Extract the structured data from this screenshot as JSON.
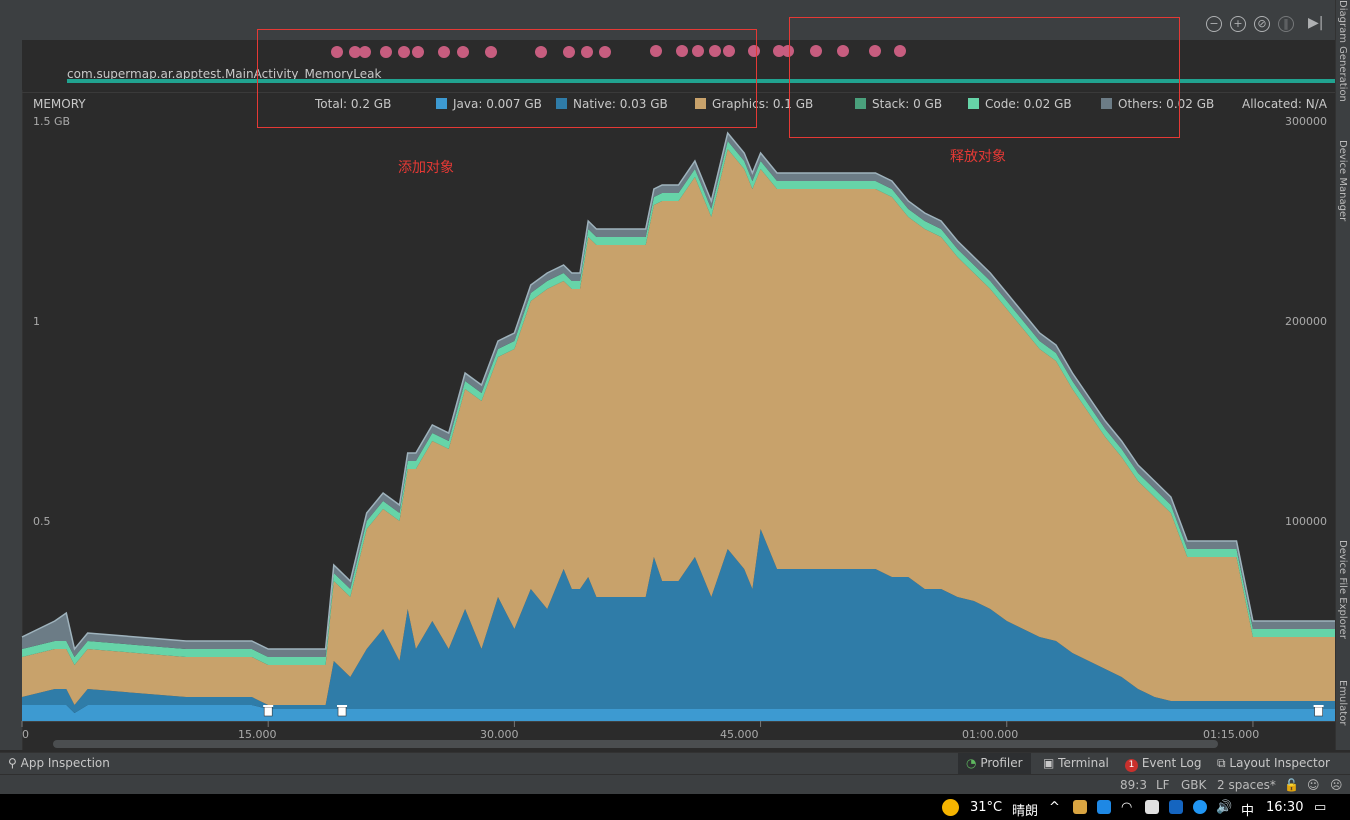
{
  "app": {
    "title": "Android Studio Memory Profiler"
  },
  "toolbar": {
    "icons": [
      "zoom-out-icon",
      "zoom-in-icon",
      "reset-zoom-icon",
      "pause-icon",
      "go-live-icon"
    ]
  },
  "right_strip": {
    "labels": [
      "Diagram Generation",
      "Device Manager",
      "Device File Explorer",
      "Emulator"
    ]
  },
  "session": {
    "label": "com.supermap.ar.apptest.MainActivity_MemoryLeak"
  },
  "legend": {
    "title": "MEMORY",
    "total": "Total: 0.2 GB",
    "java": "Java: 0.007 GB",
    "native": "Native: 0.03 GB",
    "graphics": "Graphics: 0.1 GB",
    "stack": "Stack: 0 GB",
    "code": "Code: 0.02 GB",
    "others": "Others: 0.02 GB",
    "allocated": "Allocated: N/A"
  },
  "colors": {
    "java": "#3d9ad1",
    "native": "#2f7ca8",
    "graphics": "#c8a26b",
    "stack": "#4aa07c",
    "code": "#66d4a8",
    "others": "#6c7c86",
    "event_dot": "#c75d7f",
    "annotation": "#e53935",
    "session_bar": "#21a390"
  },
  "annotations": {
    "add": "添加对象",
    "release": "释放对象"
  },
  "chart_data": {
    "type": "area",
    "title": "",
    "y_left_ticks": [
      "1.5 GB",
      "1",
      "0.5"
    ],
    "y_right_ticks": [
      "300000",
      "200000",
      "100000"
    ],
    "x_ticks": [
      "0",
      "15.000",
      "30.000",
      "45.000",
      "01:00.000",
      "01:15.000"
    ],
    "ylim": [
      0,
      1.5
    ],
    "xlim_seconds": [
      0,
      80
    ],
    "x": [
      0,
      1,
      2,
      2.7,
      3.2,
      4,
      10,
      14,
      15,
      18.5,
      19,
      20,
      21,
      22,
      23,
      23.5,
      24,
      25,
      26,
      27,
      28,
      29,
      30,
      31,
      32,
      33,
      33.5,
      34,
      34.5,
      35,
      36,
      36.5,
      38,
      38.5,
      39,
      40,
      41,
      42,
      43,
      44,
      44.5,
      45,
      46,
      47,
      48,
      49,
      50,
      51,
      52,
      53,
      54,
      55,
      56,
      57,
      58,
      59,
      60,
      61,
      62,
      63,
      64,
      65,
      66,
      67,
      68,
      69,
      70,
      71,
      72,
      73,
      74,
      75,
      76,
      77,
      78,
      79,
      80
    ],
    "series": [
      {
        "name": "Java",
        "values": [
          0.04,
          0.04,
          0.04,
          0.04,
          0.02,
          0.04,
          0.04,
          0.04,
          0.03,
          0.03,
          0.03,
          0.03,
          0.03,
          0.03,
          0.03,
          0.03,
          0.03,
          0.03,
          0.03,
          0.03,
          0.03,
          0.03,
          0.03,
          0.03,
          0.03,
          0.03,
          0.03,
          0.03,
          0.03,
          0.03,
          0.03,
          0.03,
          0.03,
          0.03,
          0.03,
          0.03,
          0.03,
          0.03,
          0.03,
          0.03,
          0.03,
          0.03,
          0.03,
          0.03,
          0.03,
          0.03,
          0.03,
          0.03,
          0.03,
          0.03,
          0.03,
          0.03,
          0.03,
          0.03,
          0.03,
          0.03,
          0.03,
          0.03,
          0.03,
          0.03,
          0.03,
          0.03,
          0.03,
          0.03,
          0.03,
          0.03,
          0.03,
          0.03,
          0.03,
          0.03,
          0.03,
          0.03,
          0.03,
          0.03,
          0.03,
          0.03,
          0.03
        ]
      },
      {
        "name": "Native",
        "values": [
          0.02,
          0.03,
          0.04,
          0.04,
          0.02,
          0.04,
          0.02,
          0.02,
          0.01,
          0.01,
          0.12,
          0.08,
          0.15,
          0.2,
          0.12,
          0.25,
          0.15,
          0.22,
          0.15,
          0.25,
          0.15,
          0.28,
          0.2,
          0.3,
          0.25,
          0.35,
          0.3,
          0.3,
          0.33,
          0.28,
          0.28,
          0.28,
          0.28,
          0.38,
          0.32,
          0.32,
          0.38,
          0.28,
          0.4,
          0.35,
          0.3,
          0.45,
          0.35,
          0.35,
          0.35,
          0.35,
          0.35,
          0.35,
          0.35,
          0.33,
          0.33,
          0.3,
          0.3,
          0.28,
          0.27,
          0.25,
          0.22,
          0.2,
          0.18,
          0.17,
          0.14,
          0.12,
          0.1,
          0.08,
          0.05,
          0.03,
          0.02,
          0.02,
          0.02,
          0.02,
          0.02,
          0.02,
          0.02,
          0.02,
          0.02,
          0.02,
          0.02
        ]
      },
      {
        "name": "Graphics",
        "values": [
          0.1,
          0.1,
          0.1,
          0.1,
          0.1,
          0.1,
          0.1,
          0.1,
          0.1,
          0.1,
          0.2,
          0.2,
          0.3,
          0.3,
          0.35,
          0.35,
          0.45,
          0.45,
          0.5,
          0.55,
          0.62,
          0.6,
          0.7,
          0.72,
          0.8,
          0.72,
          0.75,
          0.75,
          0.85,
          0.88,
          0.88,
          0.88,
          0.88,
          0.88,
          0.95,
          0.95,
          0.95,
          0.95,
          1.0,
          1.0,
          1.0,
          0.9,
          0.95,
          0.95,
          0.95,
          0.95,
          0.95,
          0.95,
          0.95,
          0.95,
          0.9,
          0.9,
          0.88,
          0.85,
          0.82,
          0.8,
          0.78,
          0.75,
          0.72,
          0.7,
          0.66,
          0.62,
          0.58,
          0.55,
          0.52,
          0.5,
          0.47,
          0.36,
          0.36,
          0.36,
          0.36,
          0.16,
          0.16,
          0.16,
          0.16,
          0.16,
          0.16
        ]
      },
      {
        "name": "Stack",
        "values": [
          0.0,
          0.0,
          0.0,
          0.0,
          0.0,
          0.0,
          0.0,
          0.0,
          0.0,
          0.0,
          0.0,
          0.0,
          0.0,
          0.0,
          0.0,
          0.0,
          0.0,
          0.0,
          0.0,
          0.0,
          0.0,
          0.0,
          0.0,
          0.0,
          0.0,
          0.0,
          0.0,
          0.0,
          0.0,
          0.0,
          0.0,
          0.0,
          0.0,
          0.0,
          0.0,
          0.0,
          0.0,
          0.0,
          0.0,
          0.0,
          0.0,
          0.0,
          0.0,
          0.0,
          0.0,
          0.0,
          0.0,
          0.0,
          0.0,
          0.0,
          0.0,
          0.0,
          0.0,
          0.0,
          0.0,
          0.0,
          0.0,
          0.0,
          0.0,
          0.0,
          0.0,
          0.0,
          0.0,
          0.0,
          0.0,
          0.0,
          0.0,
          0.0,
          0.0,
          0.0,
          0.0,
          0.0,
          0.0,
          0.0,
          0.0,
          0.0,
          0.0
        ]
      },
      {
        "name": "Code",
        "values": [
          0.02,
          0.02,
          0.02,
          0.02,
          0.02,
          0.02,
          0.02,
          0.02,
          0.02,
          0.02,
          0.02,
          0.02,
          0.02,
          0.02,
          0.02,
          0.02,
          0.02,
          0.02,
          0.02,
          0.02,
          0.02,
          0.02,
          0.02,
          0.02,
          0.02,
          0.02,
          0.02,
          0.02,
          0.02,
          0.02,
          0.02,
          0.02,
          0.02,
          0.02,
          0.02,
          0.02,
          0.02,
          0.02,
          0.02,
          0.02,
          0.02,
          0.02,
          0.02,
          0.02,
          0.02,
          0.02,
          0.02,
          0.02,
          0.02,
          0.02,
          0.02,
          0.02,
          0.02,
          0.02,
          0.02,
          0.02,
          0.02,
          0.02,
          0.02,
          0.02,
          0.02,
          0.02,
          0.02,
          0.02,
          0.02,
          0.02,
          0.02,
          0.02,
          0.02,
          0.02,
          0.02,
          0.02,
          0.02,
          0.02,
          0.02,
          0.02,
          0.02
        ]
      },
      {
        "name": "Others",
        "values": [
          0.03,
          0.04,
          0.05,
          0.07,
          0.02,
          0.02,
          0.02,
          0.02,
          0.02,
          0.02,
          0.02,
          0.02,
          0.02,
          0.02,
          0.02,
          0.02,
          0.02,
          0.02,
          0.02,
          0.02,
          0.02,
          0.02,
          0.02,
          0.02,
          0.02,
          0.02,
          0.02,
          0.02,
          0.02,
          0.02,
          0.02,
          0.02,
          0.02,
          0.02,
          0.02,
          0.02,
          0.02,
          0.02,
          0.02,
          0.02,
          0.02,
          0.02,
          0.02,
          0.02,
          0.02,
          0.02,
          0.02,
          0.02,
          0.02,
          0.02,
          0.02,
          0.02,
          0.02,
          0.02,
          0.02,
          0.02,
          0.02,
          0.02,
          0.02,
          0.02,
          0.02,
          0.02,
          0.02,
          0.02,
          0.02,
          0.02,
          0.02,
          0.02,
          0.02,
          0.02,
          0.02,
          0.02,
          0.02,
          0.02,
          0.02,
          0.02,
          0.02
        ]
      }
    ],
    "gc_events_seconds": [
      15,
      19.5,
      79
    ],
    "alloc_event_seconds": [
      19.2,
      20.3,
      20.9,
      22.2,
      23.3,
      24.1,
      25.7,
      26.9,
      28.6,
      31.6,
      33.3,
      34.4,
      35.5,
      38.6,
      40.2,
      41.2,
      42.2,
      43.1,
      44.6,
      46.1,
      46.7,
      48.4,
      50.0,
      52.0,
      53.5
    ]
  },
  "bottom_tabs": {
    "app_inspection": "App Inspection",
    "profiler": "Profiler",
    "terminal": "Terminal",
    "event_log": "Event Log",
    "event_log_badge": "1",
    "layout_inspector": "Layout Inspector"
  },
  "status": {
    "position": "89:3",
    "line_sep": "LF",
    "encoding": "GBK",
    "indent": "2 spaces*"
  },
  "taskbar": {
    "temperature": "31°C",
    "weather": "晴朗",
    "ime": "中",
    "clock": "16:30"
  }
}
